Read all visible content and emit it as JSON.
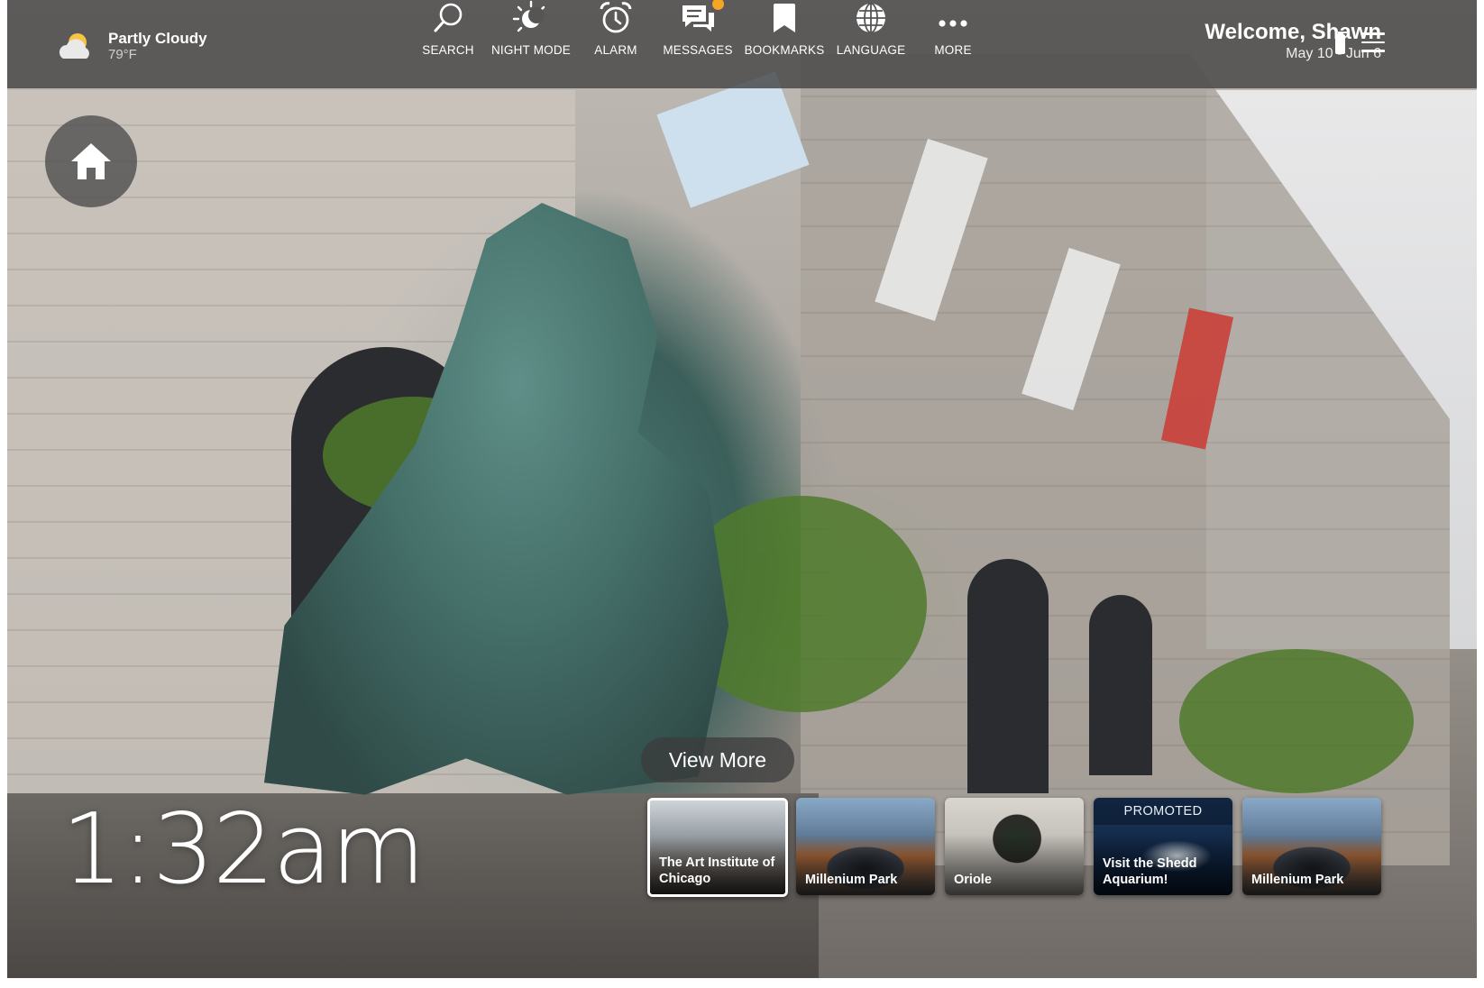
{
  "weather": {
    "condition": "Partly Cloudy",
    "temperature": "79°F",
    "icon": "partly-cloudy-icon"
  },
  "nav": [
    {
      "label": "SEARCH",
      "icon": "search-icon"
    },
    {
      "label": "NIGHT MODE",
      "icon": "night-mode-icon"
    },
    {
      "label": "ALARM",
      "icon": "alarm-icon"
    },
    {
      "label": "MESSAGES",
      "icon": "messages-icon",
      "has_notification": true
    },
    {
      "label": "BOOKMARKS",
      "icon": "bookmark-icon"
    },
    {
      "label": "LANGUAGE",
      "icon": "globe-icon"
    },
    {
      "label": "MORE",
      "icon": "more-icon"
    }
  ],
  "user": {
    "welcome": "Welcome, Shawn",
    "dates": "May 10 - Jun 6"
  },
  "clock": {
    "time": "1:32am"
  },
  "view_more_label": "View More",
  "cards": [
    {
      "title": "The Art Institute of Chicago",
      "promoted": false,
      "active": true
    },
    {
      "title": "Millenium Park",
      "promoted": false,
      "active": false
    },
    {
      "title": "Oriole",
      "promoted": false,
      "active": false
    },
    {
      "title": "Visit the Shedd Aquarium!",
      "promoted": true,
      "promo_label": "PROMOTED",
      "active": false
    },
    {
      "title": "Millenium Park",
      "promoted": false,
      "active": false
    }
  ],
  "colors": {
    "notification_badge": "#f5a623",
    "topbar": "#464646"
  }
}
